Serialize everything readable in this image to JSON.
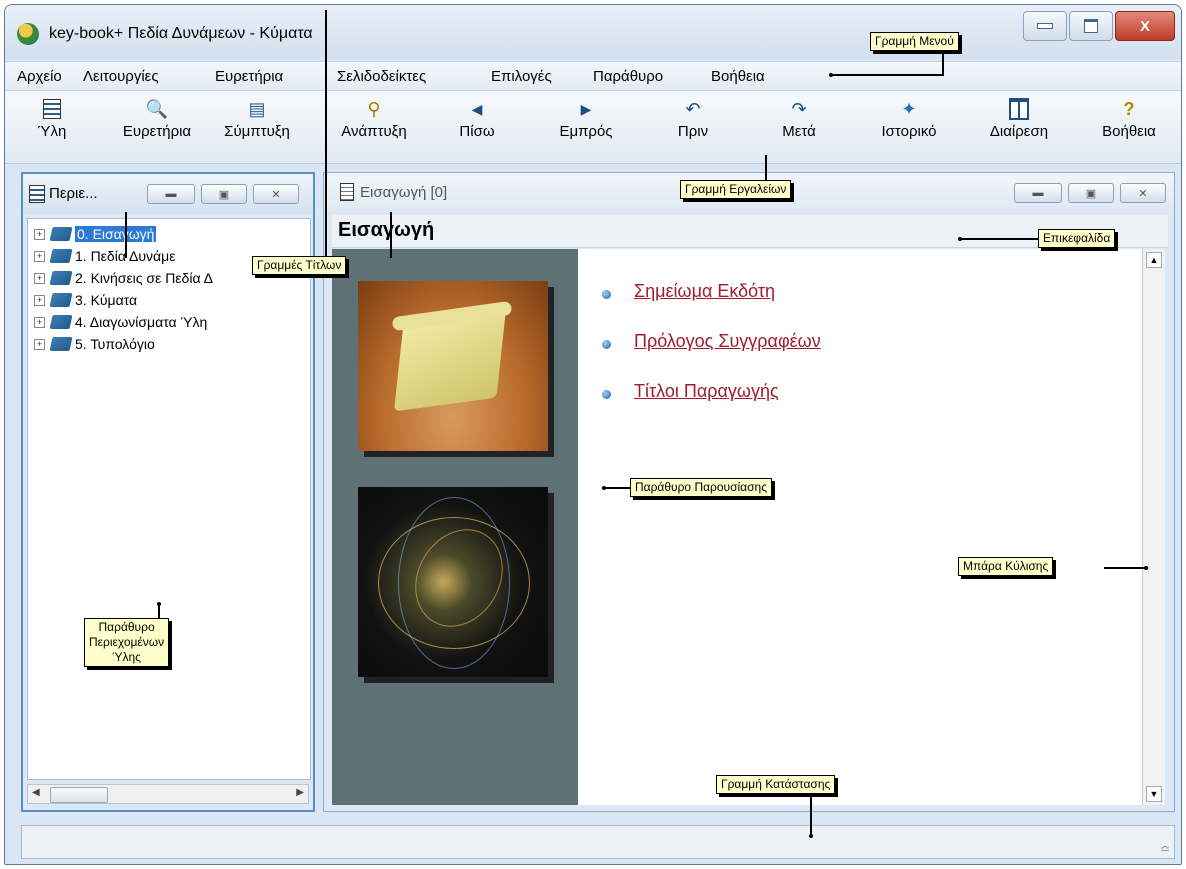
{
  "window": {
    "title": "key-book+  Πεδία Δυνάμεων - Κύματα",
    "close_label": "X"
  },
  "menu": [
    "Αρχείο",
    "Λειτουργίες",
    "Ευρετήρια",
    "Σελιδοδείκτες",
    "Επιλογές",
    "Παράθυρο",
    "Βοήθεια"
  ],
  "toolbar": [
    {
      "label": "Ύλη",
      "icon": "book-list-icon"
    },
    {
      "label": "Ευρετήρια",
      "icon": "magnifier-icon"
    },
    {
      "label": "Σύμπτυξη",
      "icon": "collapse-icon"
    },
    {
      "label": "Ανάπτυξη",
      "icon": "expand-icon"
    },
    {
      "label": "Πίσω",
      "icon": "back-arrow-icon"
    },
    {
      "label": "Εμπρός",
      "icon": "forward-arrow-icon"
    },
    {
      "label": "Πριν",
      "icon": "undo-icon"
    },
    {
      "label": "Μετά",
      "icon": "redo-icon"
    },
    {
      "label": "Ιστορικό",
      "icon": "history-icon"
    },
    {
      "label": "Διαίρεση",
      "icon": "split-icon"
    },
    {
      "label": "Βοήθεια",
      "icon": "help-icon"
    }
  ],
  "left_panel": {
    "title": "Περιε...",
    "tree": [
      "0. Εισαγωγή",
      "1. Πεδία Δυνάμε",
      "2. Κινήσεις σε Πεδία Δ",
      "3. Κύματα",
      "4. Διαγωνίσματα Ύλη",
      "5. Τυπολόγιο"
    ]
  },
  "right_panel": {
    "title": "Εισαγωγή  [0]",
    "header": "Εισαγωγή",
    "links": [
      "Σημείωμα Εκδότη",
      "Πρόλογος Συγγραφέων",
      "Τίτλοι Παραγωγής"
    ]
  },
  "callouts": {
    "menu_bar": "Γραμμή Μενού",
    "toolbar": "Γραμμή Εργαλείων",
    "title_bars": "Γραμμές Τίτλων",
    "header": "Επικεφαλίδα",
    "presentation": "Παράθυρο Παρουσίασης",
    "scrollbar": "Μπάρα Κύλισης",
    "contents_line1": "Παράθυρο",
    "contents_line2": "Περιεχομένων",
    "contents_line3": "Ύλης",
    "statusbar": "Γραμμή Κατάστασης"
  }
}
